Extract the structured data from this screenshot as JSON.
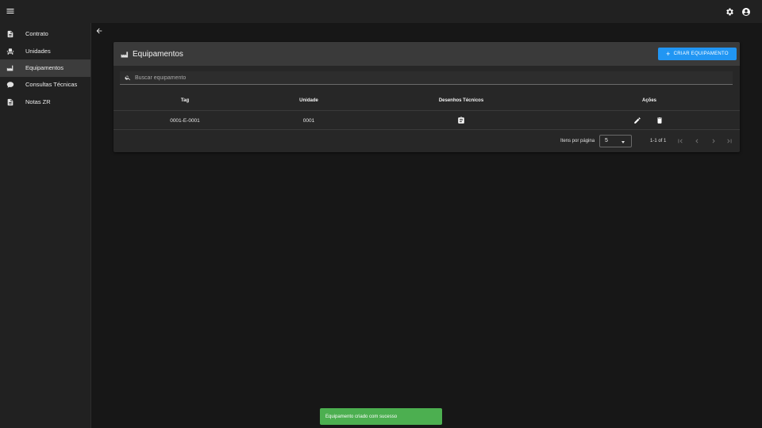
{
  "topbar": {
    "menu_icon": "menu-icon",
    "settings_icon": "gear-icon",
    "account_icon": "account-circle-icon"
  },
  "sidebar": {
    "items": [
      {
        "label": "Contrato",
        "icon": "file-document-icon",
        "active": false
      },
      {
        "label": "Unidades",
        "icon": "factory-icon",
        "active": false
      },
      {
        "label": "Equipamentos",
        "icon": "industry-equipment-icon",
        "active": true
      },
      {
        "label": "Consultas Técnicas",
        "icon": "comment-icon",
        "active": false
      },
      {
        "label": "Notas ZR",
        "icon": "file-document-icon",
        "active": false
      }
    ]
  },
  "main": {
    "back_icon": "arrow-left-icon",
    "title": "Equipamentos",
    "create_button": "CRIAR EQUIPAMENTO",
    "search_placeholder": "Buscar equipamento",
    "search_value": "",
    "table": {
      "columns": [
        "Tag",
        "Unidade",
        "Desenhos Técnicos",
        "Ações"
      ],
      "rows": [
        {
          "tag": "0001-E-0001",
          "unidade": "0001",
          "desenhos_icon": "clipboard-icon",
          "actions": [
            "pencil-icon",
            "trash-icon"
          ]
        }
      ]
    },
    "pagination": {
      "items_per_page_label": "Itens por página",
      "items_per_page": "5",
      "range": "1-1 of 1"
    }
  },
  "toast": {
    "message": "Equipamento criado com sucesso"
  },
  "colors": {
    "primary": "#2196f3",
    "success": "#4caf50",
    "background": "#171717",
    "surface": "#272727",
    "header": "#3a3a3a"
  }
}
